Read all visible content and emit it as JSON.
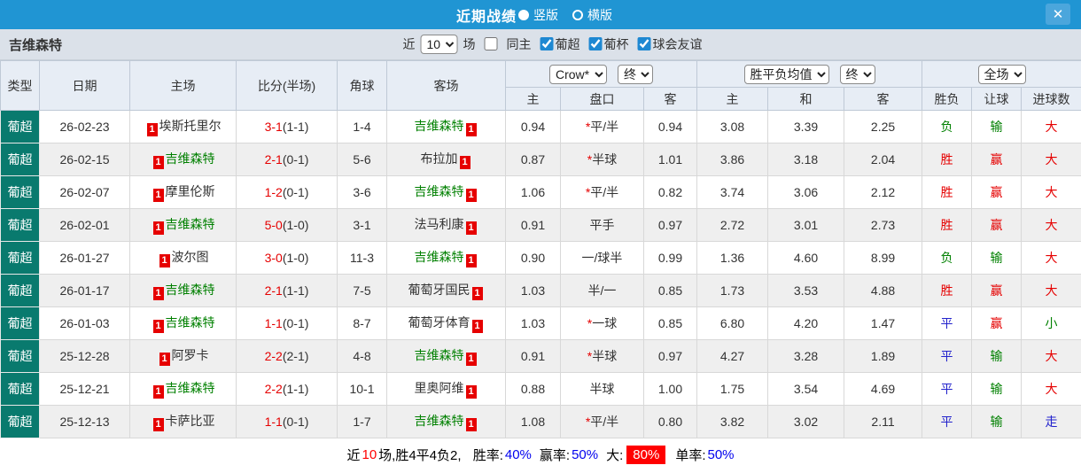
{
  "titlebar": {
    "title": "近期战绩",
    "view_options": [
      {
        "label": "竖版",
        "selected": true
      },
      {
        "label": "横版",
        "selected": false
      }
    ],
    "close_label": "✕"
  },
  "filterbar": {
    "team": "吉维森特",
    "near_label": "近",
    "count_value": "10",
    "games_label": "场",
    "checkboxes": [
      {
        "label": "同主",
        "checked": false
      },
      {
        "label": "葡超",
        "checked": true
      },
      {
        "label": "葡杯",
        "checked": true
      },
      {
        "label": "球会友谊",
        "checked": true
      }
    ]
  },
  "table": {
    "card_label": "1",
    "selects": {
      "bookmaker": "Crow*",
      "bookmaker_time": "终",
      "avg_type": "胜平负均值",
      "avg_time": "终",
      "scope": "全场"
    },
    "columns": {
      "type": "类型",
      "date": "日期",
      "home": "主场",
      "score": "比分(半场)",
      "corner": "角球",
      "away": "客场",
      "o_home": "主",
      "o_line": "盘口",
      "o_away": "客",
      "a_home": "主",
      "a_draw": "和",
      "a_away": "客",
      "wdl": "胜负",
      "let": "让球",
      "goals": "进球数"
    },
    "rows": [
      {
        "league": "葡超",
        "date": "26-02-23",
        "home": "埃斯托里尔",
        "home_card": false,
        "home_green": false,
        "score": "3-1",
        "half": "(1-1)",
        "corner": "1-4",
        "away": "吉维森特",
        "away_card": false,
        "away_green": true,
        "o_home": "0.94",
        "o_star": true,
        "o_line": "平/半",
        "o_away": "0.94",
        "a_home": "3.08",
        "a_draw": "3.39",
        "a_away": "2.25",
        "wdl": {
          "t": "负",
          "c": "g"
        },
        "let": {
          "t": "输",
          "c": "g"
        },
        "goal": {
          "t": "大",
          "c": "r"
        }
      },
      {
        "league": "葡超",
        "date": "26-02-15",
        "home": "吉维森特",
        "home_card": false,
        "home_green": true,
        "score": "2-1",
        "half": "(0-1)",
        "corner": "5-6",
        "away": "布拉加",
        "away_card": false,
        "away_green": false,
        "o_home": "0.87",
        "o_star": true,
        "o_line": "半球",
        "o_away": "1.01",
        "a_home": "3.86",
        "a_draw": "3.18",
        "a_away": "2.04",
        "wdl": {
          "t": "胜",
          "c": "r"
        },
        "let": {
          "t": "赢",
          "c": "r"
        },
        "goal": {
          "t": "大",
          "c": "r"
        }
      },
      {
        "league": "葡超",
        "date": "26-02-07",
        "home": "摩里伦斯",
        "home_card": true,
        "home_green": false,
        "score": "1-2",
        "half": "(0-1)",
        "corner": "3-6",
        "away": "吉维森特",
        "away_card": false,
        "away_green": true,
        "o_home": "1.06",
        "o_star": true,
        "o_line": "平/半",
        "o_away": "0.82",
        "a_home": "3.74",
        "a_draw": "3.06",
        "a_away": "2.12",
        "wdl": {
          "t": "胜",
          "c": "r"
        },
        "let": {
          "t": "赢",
          "c": "r"
        },
        "goal": {
          "t": "大",
          "c": "r"
        }
      },
      {
        "league": "葡超",
        "date": "26-02-01",
        "home": "吉维森特",
        "home_card": false,
        "home_green": true,
        "score": "5-0",
        "half": "(1-0)",
        "corner": "3-1",
        "away": "法马利康",
        "away_card": true,
        "away_green": false,
        "o_home": "0.91",
        "o_star": false,
        "o_line": "平手",
        "o_away": "0.97",
        "a_home": "2.72",
        "a_draw": "3.01",
        "a_away": "2.73",
        "wdl": {
          "t": "胜",
          "c": "r"
        },
        "let": {
          "t": "赢",
          "c": "r"
        },
        "goal": {
          "t": "大",
          "c": "r"
        }
      },
      {
        "league": "葡超",
        "date": "26-01-27",
        "home": "波尔图",
        "home_card": false,
        "home_green": false,
        "score": "3-0",
        "half": "(1-0)",
        "corner": "11-3",
        "away": "吉维森特",
        "away_card": true,
        "away_green": true,
        "o_home": "0.90",
        "o_star": false,
        "o_line": "一/球半",
        "o_away": "0.99",
        "a_home": "1.36",
        "a_draw": "4.60",
        "a_away": "8.99",
        "wdl": {
          "t": "负",
          "c": "g"
        },
        "let": {
          "t": "输",
          "c": "g"
        },
        "goal": {
          "t": "大",
          "c": "r"
        }
      },
      {
        "league": "葡超",
        "date": "26-01-17",
        "home": "吉维森特",
        "home_card": false,
        "home_green": true,
        "score": "2-1",
        "half": "(1-1)",
        "corner": "7-5",
        "away": "葡萄牙国民",
        "away_card": false,
        "away_green": false,
        "o_home": "1.03",
        "o_star": false,
        "o_line": "半/一",
        "o_away": "0.85",
        "a_home": "1.73",
        "a_draw": "3.53",
        "a_away": "4.88",
        "wdl": {
          "t": "胜",
          "c": "r"
        },
        "let": {
          "t": "赢",
          "c": "r"
        },
        "goal": {
          "t": "大",
          "c": "r"
        }
      },
      {
        "league": "葡超",
        "date": "26-01-03",
        "home": "吉维森特",
        "home_card": false,
        "home_green": true,
        "score": "1-1",
        "half": "(0-1)",
        "corner": "8-7",
        "away": "葡萄牙体育",
        "away_card": true,
        "away_green": false,
        "o_home": "1.03",
        "o_star": true,
        "o_line": "一球",
        "o_away": "0.85",
        "a_home": "6.80",
        "a_draw": "4.20",
        "a_away": "1.47",
        "wdl": {
          "t": "平",
          "c": "b"
        },
        "let": {
          "t": "赢",
          "c": "r"
        },
        "goal": {
          "t": "小",
          "c": "g"
        }
      },
      {
        "league": "葡超",
        "date": "25-12-28",
        "home": "阿罗卡",
        "home_card": false,
        "home_green": false,
        "score": "2-2",
        "half": "(2-1)",
        "corner": "4-8",
        "away": "吉维森特",
        "away_card": false,
        "away_green": true,
        "o_home": "0.91",
        "o_star": true,
        "o_line": "半球",
        "o_away": "0.97",
        "a_home": "4.27",
        "a_draw": "3.28",
        "a_away": "1.89",
        "wdl": {
          "t": "平",
          "c": "b"
        },
        "let": {
          "t": "输",
          "c": "g"
        },
        "goal": {
          "t": "大",
          "c": "r"
        }
      },
      {
        "league": "葡超",
        "date": "25-12-21",
        "home": "吉维森特",
        "home_card": false,
        "home_green": true,
        "score": "2-2",
        "half": "(1-1)",
        "corner": "10-1",
        "away": "里奥阿维",
        "away_card": true,
        "away_green": false,
        "o_home": "0.88",
        "o_star": false,
        "o_line": "半球",
        "o_away": "1.00",
        "a_home": "1.75",
        "a_draw": "3.54",
        "a_away": "4.69",
        "wdl": {
          "t": "平",
          "c": "b"
        },
        "let": {
          "t": "输",
          "c": "g"
        },
        "goal": {
          "t": "大",
          "c": "r"
        }
      },
      {
        "league": "葡超",
        "date": "25-12-13",
        "home": "卡萨比亚",
        "home_card": false,
        "home_green": false,
        "score": "1-1",
        "half": "(0-1)",
        "corner": "1-7",
        "away": "吉维森特",
        "away_card": false,
        "away_green": true,
        "o_home": "1.08",
        "o_star": true,
        "o_line": "平/半",
        "o_away": "0.80",
        "a_home": "3.82",
        "a_draw": "3.02",
        "a_away": "2.11",
        "wdl": {
          "t": "平",
          "c": "b"
        },
        "let": {
          "t": "输",
          "c": "g"
        },
        "goal": {
          "t": "走",
          "c": "b"
        }
      }
    ]
  },
  "summary": {
    "near": "近",
    "count": "10",
    "rest": "场,胜4平4负2, ",
    "rate_label": "胜率:",
    "rate_value": "40%",
    "winodds_label": "赢率:",
    "winodds_value": "50%",
    "big_label": "大:",
    "big_value": "80%",
    "single_label": "单率:",
    "single_value": "50%"
  }
}
